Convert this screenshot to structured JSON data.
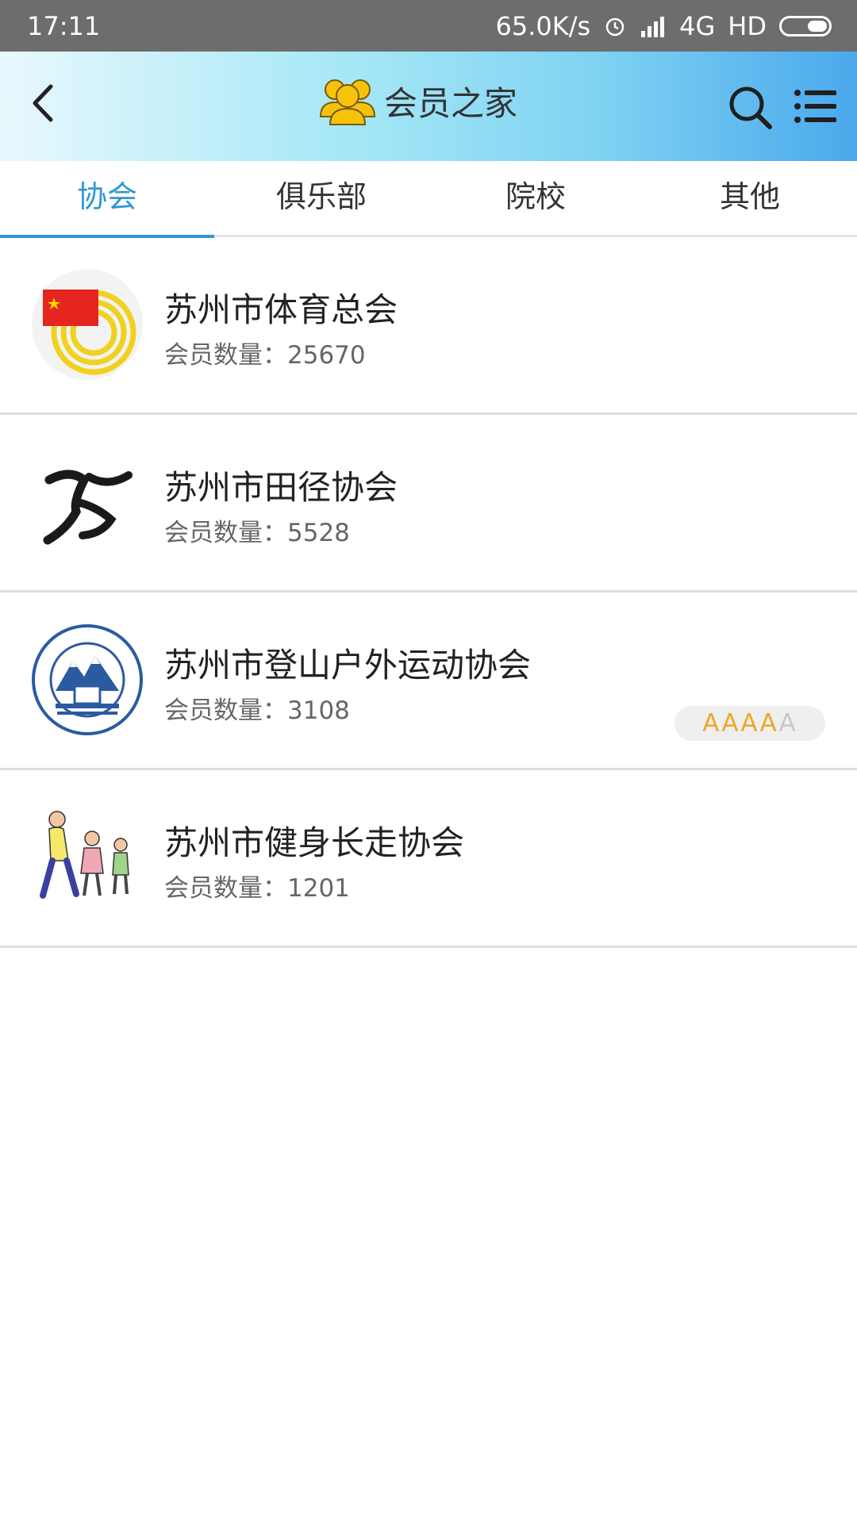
{
  "status_bar": {
    "time": "17:11",
    "speed": "65.0K/s",
    "network": "4G",
    "hd": "HD"
  },
  "header": {
    "title": "会员之家"
  },
  "tabs": [
    "协会",
    "俱乐部",
    "院校",
    "其他"
  ],
  "active_tab": 0,
  "list": [
    {
      "name": "苏州市体育总会",
      "count_label": "会员数量：",
      "count": "25670"
    },
    {
      "name": "苏州市田径协会",
      "count_label": "会员数量：",
      "count": "5528"
    },
    {
      "name": "苏州市登山户外运动协会",
      "count_label": "会员数量：",
      "count": "3108",
      "rating": "AAAA",
      "rating_rest": "A",
      "rating_value": 4,
      "rating_max": 5
    },
    {
      "name": "苏州市健身长走协会",
      "count_label": "会员数量：",
      "count": "1201"
    }
  ],
  "colors": {
    "accent": "#2f9ad3",
    "status_bar": "#6d6d6d",
    "rating": "#f0a62b"
  }
}
